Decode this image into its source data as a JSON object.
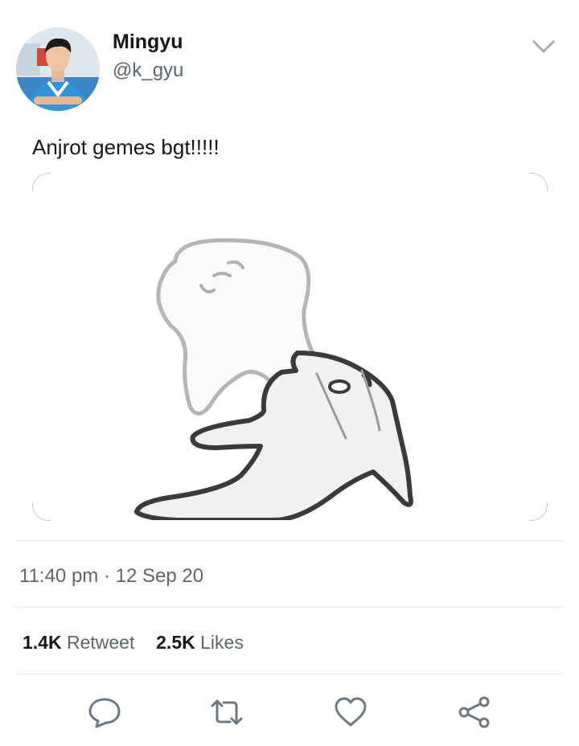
{
  "author": {
    "name": "Mingyu",
    "handle": "@k_gyu"
  },
  "tweet": {
    "text": "Anjrot gemes bgt!!!!!",
    "timestamp": "11:40 pm · 12 Sep 20"
  },
  "stats": {
    "retweets_count": "1.4K",
    "retweets_label": "Retweet",
    "likes_count": "2.5K",
    "likes_label": "Likes"
  },
  "icons": {
    "menu": "chevron-down-icon",
    "reply": "speech-bubble-icon",
    "retweet": "retweet-arrows-icon",
    "like": "heart-icon",
    "share": "share-nodes-icon"
  },
  "colors": {
    "text_primary": "#14171a",
    "text_secondary": "#5b6670",
    "icon": "#6e7880",
    "divider": "#e1e6ea"
  }
}
